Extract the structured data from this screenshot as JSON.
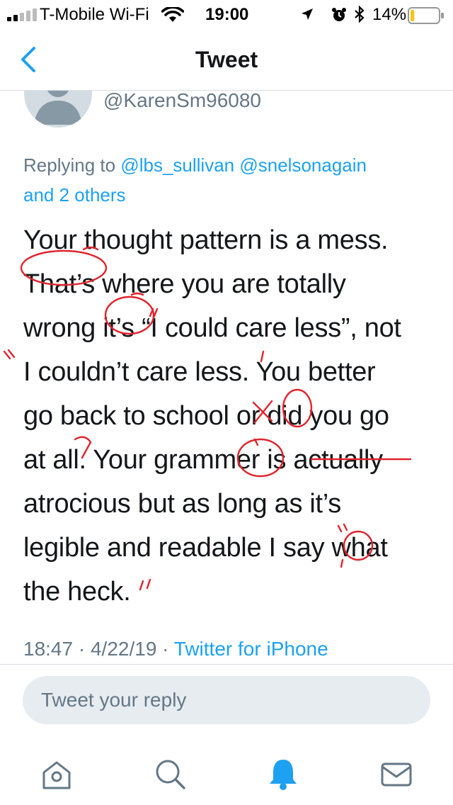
{
  "status_bar": {
    "carrier": "T-Mobile Wi-Fi",
    "time": "19:00",
    "battery_percent": "14%",
    "battery_level": 0.14,
    "icons": [
      "signal-icon",
      "wifi-icon",
      "location-icon",
      "alarm-icon",
      "bluetooth-icon",
      "battery-icon"
    ]
  },
  "nav": {
    "title": "Tweet",
    "back_icon": "chevron-left-icon"
  },
  "tweet": {
    "handle": "@KarenSm96080",
    "replying_prefix": "Replying to ",
    "reply_handle_1": "@lbs_sullivan",
    "reply_handle_2": "@snelsonagain",
    "reply_others": "and 2 others",
    "lines": [
      "Your thought pattern is a mess.",
      "That’s where you are totally",
      "wrong it’s “I could care less”, not",
      "I couldn’t care less. You better",
      "go back to school or did you go",
      "at all. Your grammer is actually",
      "atrocious but as long as it’s",
      "legible and readable I say what",
      "the heck."
    ],
    "time": "18:47",
    "date": "4/22/19",
    "separator": " · ",
    "source": "Twitter for iPhone"
  },
  "reply": {
    "placeholder": "Tweet your reply"
  },
  "tabbar": {
    "items": [
      "home-icon",
      "search-icon",
      "notifications-icon",
      "messages-icon"
    ],
    "accent": "#1da1f2",
    "inactive": "#657786"
  },
  "annotation_color": "#e0242c",
  "accent_color": "#1da1f2"
}
